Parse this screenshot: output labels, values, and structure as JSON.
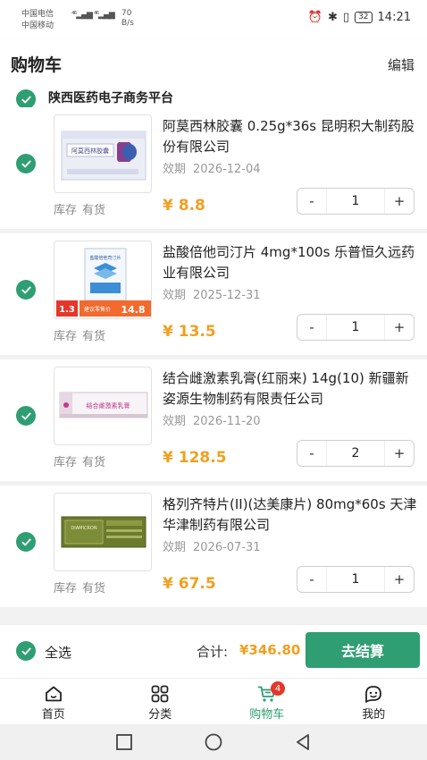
{
  "status_bar": {
    "carrier1": "中国电信",
    "carrier2": "中国移动",
    "speed_value": "70",
    "speed_unit": "B/s",
    "battery": "32",
    "time": "14:21"
  },
  "header": {
    "title": "购物车",
    "edit_label": "编辑"
  },
  "store": {
    "name": "陕西医药电子商务平台",
    "checked": true
  },
  "stock_label": "库存",
  "stock_value": "有货",
  "expiry_label": "效期",
  "items": [
    {
      "name": "阿莫西林胶囊 0.25g*36s 昆明积大制药股份有限公司",
      "expiry": "2026-12-04",
      "price": "¥ 8.8",
      "qty": "1",
      "checked": true,
      "pkg_text": "阿莫西林胶囊"
    },
    {
      "name": "盐酸倍他司汀片 4mg*100s 乐普恒久远药业有限公司",
      "expiry": "2025-12-31",
      "price": "¥ 13.5",
      "qty": "1",
      "checked": true,
      "pkg_text": "盐酸倍他司汀片",
      "sticker_left": "1.3",
      "sticker_right_label": "建议零售价",
      "sticker_right": "14.8"
    },
    {
      "name": "结合雌激素乳膏(红丽来) 14g(10) 新疆新姿源生物制药有限责任公司",
      "expiry": "2026-11-20",
      "price": "¥ 128.5",
      "qty": "2",
      "checked": true,
      "pkg_text": "结合雌激素乳膏"
    },
    {
      "name": "格列齐特片(II)(达美康片) 80mg*60s 天津华津制药有限公司",
      "expiry": "2026-07-31",
      "price": "¥ 67.5",
      "qty": "1",
      "checked": true,
      "pkg_text": "DIAMICRON"
    }
  ],
  "stepper": {
    "minus": "-",
    "plus": "+"
  },
  "checkout": {
    "select_all_label": "全选",
    "total_label": "合计:",
    "total_value": "¥346.80",
    "pay_label": "去结算"
  },
  "nav": {
    "tabs": [
      {
        "label": "首页",
        "icon": "home-icon"
      },
      {
        "label": "分类",
        "icon": "category-grid-icon"
      },
      {
        "label": "购物车",
        "icon": "cart-icon",
        "badge": "4",
        "active": true
      },
      {
        "label": "我的",
        "icon": "profile-icon"
      }
    ]
  },
  "colors": {
    "accent": "#2f9e72",
    "price": "#f0a020",
    "badge": "#e5362b"
  }
}
